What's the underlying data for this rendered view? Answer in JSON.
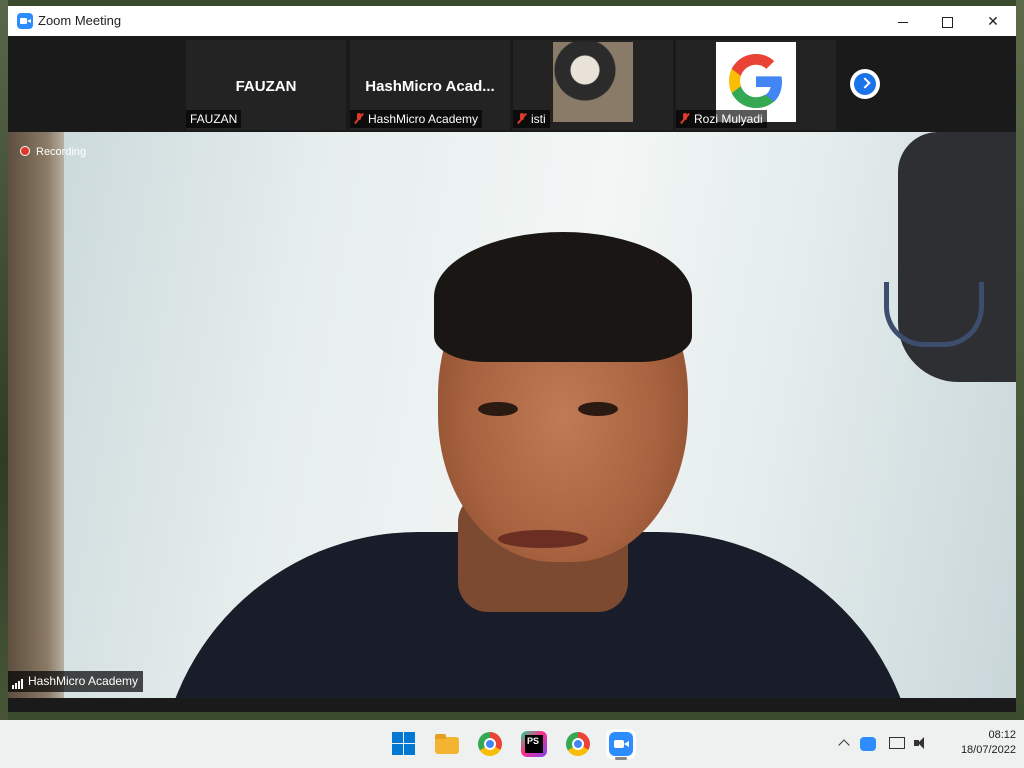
{
  "window": {
    "title": "Zoom Meeting",
    "minimize": "",
    "maximize": "",
    "close": "✕"
  },
  "participants": {
    "tiles": [
      {
        "display": "FAUZAN",
        "label": "FAUZAN",
        "muted": false
      },
      {
        "display": "HashMicro  Acad...",
        "label": "HashMicro Academy",
        "muted": true
      },
      {
        "display": "",
        "label": "isti",
        "muted": true,
        "video": true
      },
      {
        "display": "",
        "label": "Rozi Mulyadi",
        "muted": true,
        "video": true
      }
    ],
    "next_icon": "chevron-right"
  },
  "main_video": {
    "recording_label": "Recording",
    "speaker_name": "HashMicro Academy"
  },
  "taskbar": {
    "apps": [
      "start",
      "file-explorer",
      "chrome",
      "phpstorm",
      "chrome",
      "zoom"
    ],
    "phpstorm_text": "PS",
    "clock_time": "08:12",
    "clock_date": "18/07/2022"
  },
  "colors": {
    "zoom_blue": "#2d8cff",
    "mute_red": "#e0392b",
    "strip_bg": "#1a1a1a"
  }
}
